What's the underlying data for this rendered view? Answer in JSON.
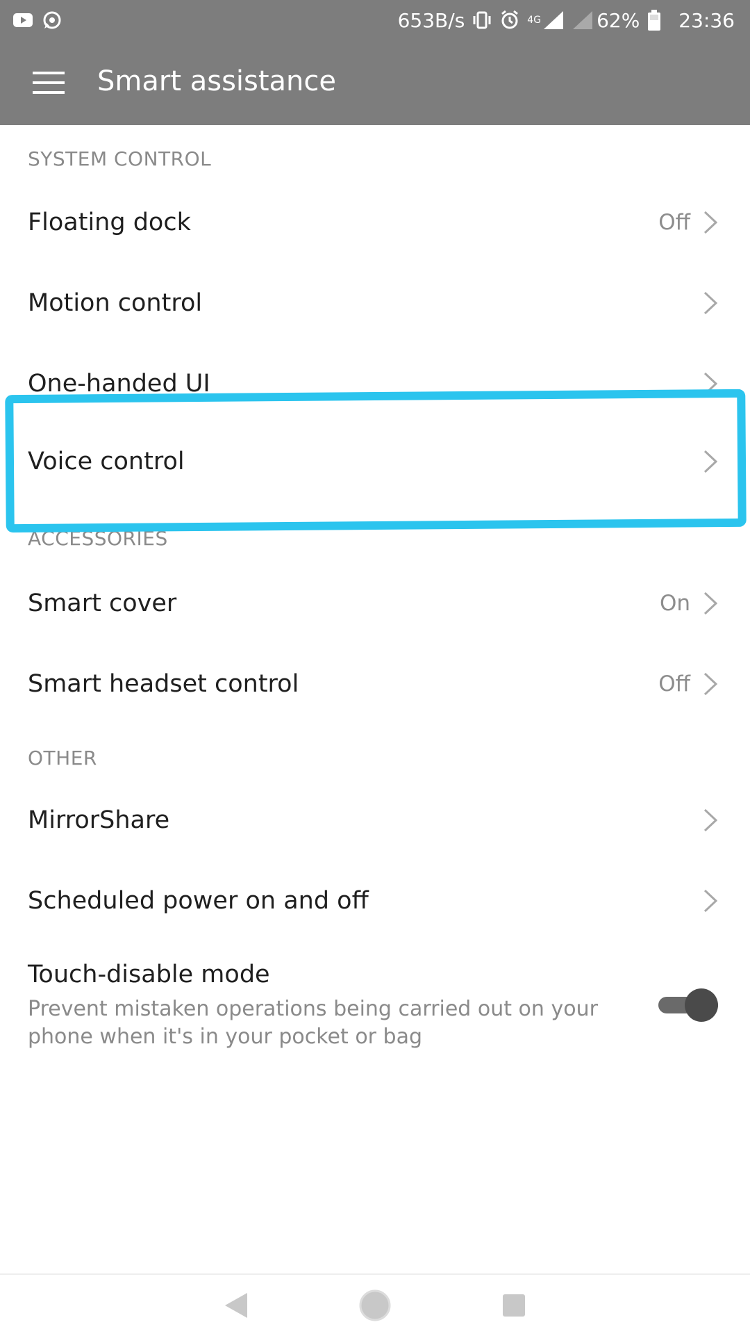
{
  "status_bar": {
    "net_speed": "653B/s",
    "network_type": "4G",
    "battery": "62%",
    "time": "23:36",
    "left_icons": [
      "youtube-icon",
      "whatsapp-icon"
    ],
    "right_icons": [
      "vibrate-icon",
      "alarm-icon",
      "signal-icon",
      "signal-icon",
      "battery-icon"
    ]
  },
  "app_bar": {
    "title": "Smart assistance",
    "menu_icon": "hamburger-menu-icon"
  },
  "sections": [
    {
      "header": "SYSTEM CONTROL",
      "items": [
        {
          "label": "Floating dock",
          "value": "Off"
        },
        {
          "label": "Motion control",
          "value": ""
        },
        {
          "label": "One-handed UI",
          "value": ""
        },
        {
          "label": "Voice control",
          "value": ""
        }
      ]
    },
    {
      "header": "ACCESSORIES",
      "items": [
        {
          "label": "Smart cover",
          "value": "On"
        },
        {
          "label": "Smart headset control",
          "value": "Off"
        }
      ]
    },
    {
      "header": "OTHER",
      "items": [
        {
          "label": "MirrorShare",
          "value": ""
        },
        {
          "label": "Scheduled power on and off",
          "value": ""
        }
      ]
    }
  ],
  "touch_disable": {
    "title": "Touch-disable mode",
    "description": "Prevent mistaken operations being carried out on your phone when it's in your pocket or bag",
    "enabled": true
  },
  "colors": {
    "bar": "#7d7d7d",
    "highlight": "#2bc4ee",
    "secondary_text": "#8a8a8a"
  },
  "nav_bar": {
    "icons": [
      "back-icon",
      "home-icon",
      "recents-icon"
    ]
  }
}
